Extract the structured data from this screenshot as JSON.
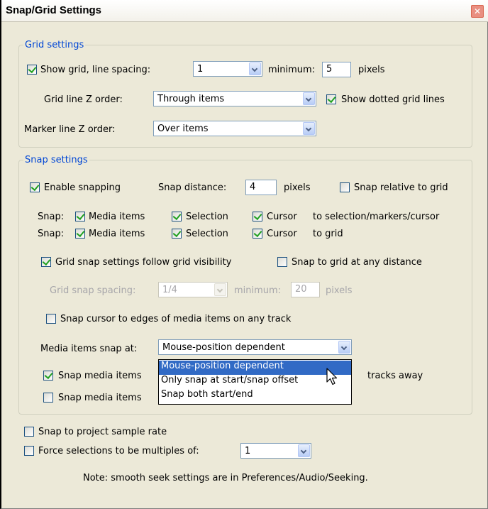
{
  "window": {
    "title": "Snap/Grid Settings"
  },
  "grid": {
    "legend": "Grid settings",
    "show_grid_label": "Show grid, line spacing:",
    "show_grid_checked": true,
    "line_spacing": "1",
    "minimum_label": "minimum:",
    "minimum_value": "5",
    "pixels_label": "pixels",
    "z_order_label": "Grid line Z order:",
    "z_order_value": "Through items",
    "dotted_label": "Show dotted grid lines",
    "dotted_checked": true,
    "marker_z_label": "Marker line Z order:",
    "marker_z_value": "Over items"
  },
  "snap": {
    "legend": "Snap settings",
    "enable_label": "Enable snapping",
    "enable_checked": true,
    "distance_label": "Snap distance:",
    "distance_value": "4",
    "pixels_label": "pixels",
    "relative_label": "Snap relative to grid",
    "relative_checked": false,
    "row1": {
      "label": "Snap:",
      "media": "Media items",
      "selection": "Selection",
      "cursor": "Cursor",
      "target": "to selection/markers/cursor"
    },
    "row2": {
      "label": "Snap:",
      "media": "Media items",
      "selection": "Selection",
      "cursor": "Cursor",
      "target": "to grid"
    },
    "follow_label": "Grid snap settings follow grid visibility",
    "follow_checked": true,
    "any_distance_label": "Snap to grid at any distance",
    "any_distance_checked": false,
    "spacing_label": "Grid snap spacing:",
    "spacing_value": "1/4",
    "spacing_min_label": "minimum:",
    "spacing_min_value": "20",
    "spacing_pixels_label": "pixels",
    "edges_label": "Snap cursor to edges of media items on any track",
    "edges_checked": false,
    "media_at_label": "Media items snap at:",
    "media_at_value": "Mouse-position dependent",
    "media1_label": "Snap media items",
    "media1_checked": true,
    "media1_suffix": "tracks away",
    "media2_label": "Snap media items",
    "media2_checked": false,
    "dropdown_options": [
      "Mouse-position dependent",
      "Only snap at start/snap offset",
      "Snap both start/end"
    ]
  },
  "bottom": {
    "sample_rate_label": "Snap to project sample rate",
    "sample_rate_checked": false,
    "force_label": "Force selections to be multiples of:",
    "force_checked": false,
    "force_value": "1",
    "note": "Note: smooth seek settings are in Preferences/Audio/Seeking."
  }
}
